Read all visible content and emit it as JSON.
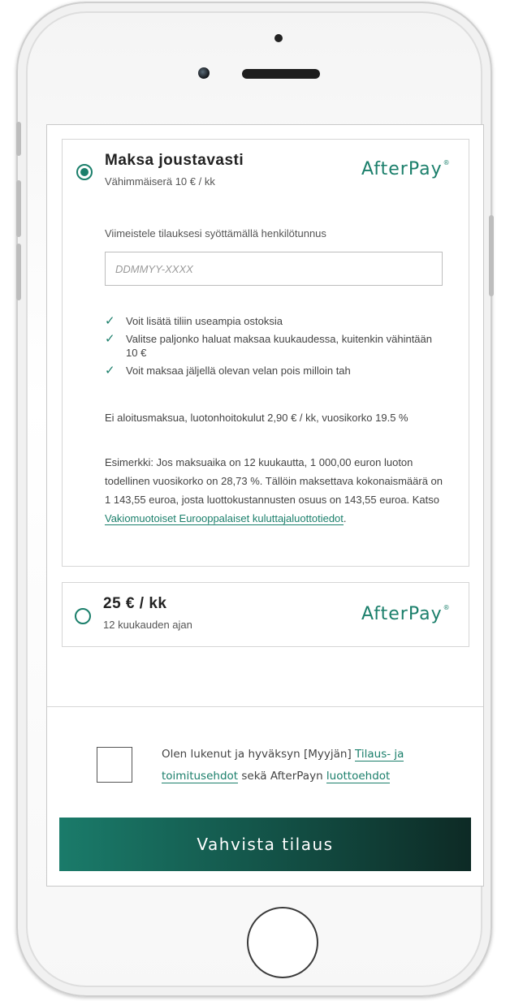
{
  "option1": {
    "title": "Maksa joustavasti",
    "subtitle": "Vähimmäiserä 10 € / kk",
    "brand": "AfterPay",
    "instruction": "Viimeistele tilauksesi syöttämällä henkilötunnus",
    "ssn_placeholder": "DDMMYY-XXXX",
    "bullets": [
      "Voit lisätä tiliin useampia ostoksia",
      "Valitse paljonko haluat maksaa kuukaudessa, kuitenkin vähintään 10 €",
      "Voit maksaa jäljellä olevan velan pois milloin tah"
    ],
    "fees": "Ei aloitusmaksua, luotonhoitokulut 2,90 € / kk, vuosikorko 19.5 %",
    "example_text": "Esimerkki: Jos maksuaika on 12 kuukautta, 1 000,00 euron luoton todellinen vuosikorko on 28,73 %. Tällöin maksettava kokonaismäärä on 1 143,55 euroa, josta luottokustannusten osuus on 143,55 euroa. Katso ",
    "example_link": "Vakiomuotoiset Eurooppalaiset kuluttajaluottotiedot",
    "example_end": "."
  },
  "option2": {
    "title": "25 € / kk",
    "subtitle": "12 kuukauden ajan",
    "brand": "AfterPay"
  },
  "terms": {
    "text_before": "Olen lukenut ja hyväksyn [Myyjän] ",
    "link1": "Tilaus- ja toimitusehdot",
    "text_middle": " sekä AfterPayn ",
    "link2": "luottoehdot"
  },
  "cta_label": "Vahvista tilaus",
  "colors": {
    "accent": "#1b7f6b",
    "cta_gradient_start": "#1a7b6a",
    "cta_gradient_end": "#0d2a25"
  }
}
